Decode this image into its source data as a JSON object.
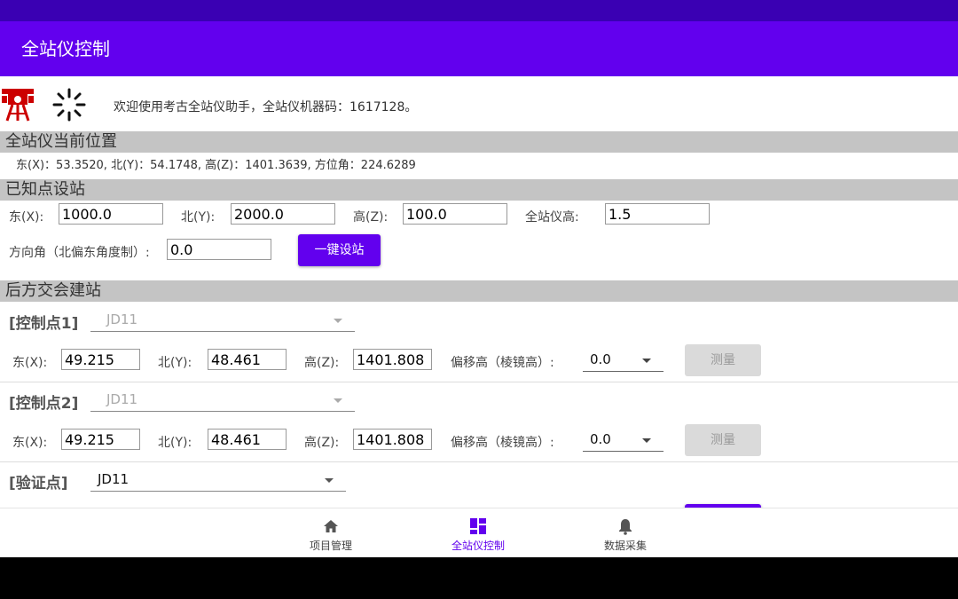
{
  "app": {
    "title": "全站仪控制"
  },
  "welcome": "欢迎使用考古全站仪助手，全站仪机器码：1617128。",
  "position": {
    "header": "全站仪当前位置",
    "text": "东(X)：53.3520,  北(Y)：54.1748,  高(Z)：1401.3639, 方位角：224.6289"
  },
  "known": {
    "header": "已知点设站",
    "east_label": "东(X):",
    "east_value": "1000.0",
    "north_label": "北(Y):",
    "north_value": "2000.0",
    "height_label": "高(Z):",
    "height_value": "100.0",
    "inst_label": "全站仪高:",
    "inst_value": "1.5",
    "azimuth_label": "方向角（北偏东角度制）:",
    "azimuth_value": "0.0",
    "setup_button": "一键设站"
  },
  "resection": {
    "header": "后方交会建站",
    "cp1": {
      "label": "[控制点1]",
      "select": "JD11",
      "east_label": "东(X):",
      "east": "49.215",
      "north_label": "北(Y):",
      "north": "48.461",
      "height_label": "高(Z):",
      "height": "1401.808",
      "offset_label": "偏移高（棱镜高）:",
      "offset": "0.0",
      "measure": "测量"
    },
    "cp2": {
      "label": "[控制点2]",
      "select": "JD11",
      "east_label": "东(X):",
      "east": "49.215",
      "north_label": "北(Y):",
      "north": "48.461",
      "height_label": "高(Z):",
      "height": "1401.808",
      "offset_label": "偏移高（棱镜高）:",
      "offset": "0.0",
      "measure": "测量"
    },
    "verify": {
      "label": "[验证点]",
      "select": "JD11"
    }
  },
  "nav": {
    "items": [
      {
        "label": "项目管理",
        "icon": "home-icon"
      },
      {
        "label": "全站仪控制",
        "icon": "dashboard-icon",
        "selected": true
      },
      {
        "label": "数据采集",
        "icon": "bell-icon"
      }
    ]
  },
  "colors": {
    "primary": "#6200ee",
    "statusbar": "#3a00b3",
    "section": "#c4c4c4"
  }
}
